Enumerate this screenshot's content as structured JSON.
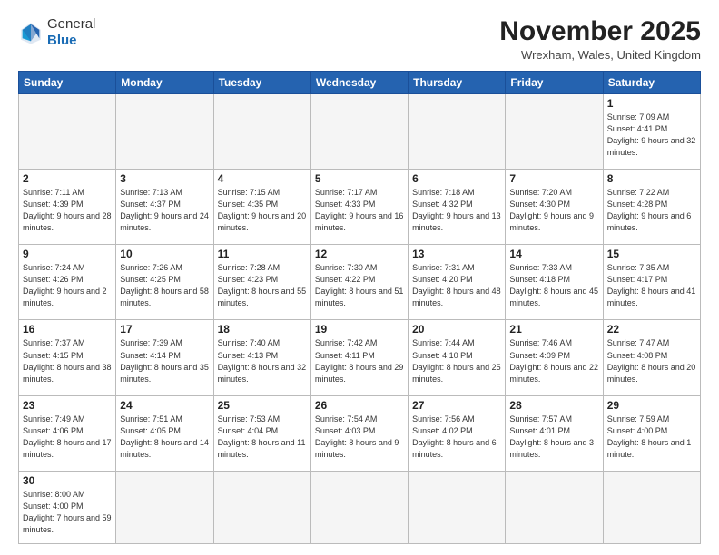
{
  "header": {
    "logo_general": "General",
    "logo_blue": "Blue",
    "title": "November 2025",
    "location": "Wrexham, Wales, United Kingdom"
  },
  "days_of_week": [
    "Sunday",
    "Monday",
    "Tuesday",
    "Wednesday",
    "Thursday",
    "Friday",
    "Saturday"
  ],
  "weeks": [
    [
      {
        "day": "",
        "info": ""
      },
      {
        "day": "",
        "info": ""
      },
      {
        "day": "",
        "info": ""
      },
      {
        "day": "",
        "info": ""
      },
      {
        "day": "",
        "info": ""
      },
      {
        "day": "",
        "info": ""
      },
      {
        "day": "1",
        "info": "Sunrise: 7:09 AM\nSunset: 4:41 PM\nDaylight: 9 hours and 32 minutes."
      }
    ],
    [
      {
        "day": "2",
        "info": "Sunrise: 7:11 AM\nSunset: 4:39 PM\nDaylight: 9 hours and 28 minutes."
      },
      {
        "day": "3",
        "info": "Sunrise: 7:13 AM\nSunset: 4:37 PM\nDaylight: 9 hours and 24 minutes."
      },
      {
        "day": "4",
        "info": "Sunrise: 7:15 AM\nSunset: 4:35 PM\nDaylight: 9 hours and 20 minutes."
      },
      {
        "day": "5",
        "info": "Sunrise: 7:17 AM\nSunset: 4:33 PM\nDaylight: 9 hours and 16 minutes."
      },
      {
        "day": "6",
        "info": "Sunrise: 7:18 AM\nSunset: 4:32 PM\nDaylight: 9 hours and 13 minutes."
      },
      {
        "day": "7",
        "info": "Sunrise: 7:20 AM\nSunset: 4:30 PM\nDaylight: 9 hours and 9 minutes."
      },
      {
        "day": "8",
        "info": "Sunrise: 7:22 AM\nSunset: 4:28 PM\nDaylight: 9 hours and 6 minutes."
      }
    ],
    [
      {
        "day": "9",
        "info": "Sunrise: 7:24 AM\nSunset: 4:26 PM\nDaylight: 9 hours and 2 minutes."
      },
      {
        "day": "10",
        "info": "Sunrise: 7:26 AM\nSunset: 4:25 PM\nDaylight: 8 hours and 58 minutes."
      },
      {
        "day": "11",
        "info": "Sunrise: 7:28 AM\nSunset: 4:23 PM\nDaylight: 8 hours and 55 minutes."
      },
      {
        "day": "12",
        "info": "Sunrise: 7:30 AM\nSunset: 4:22 PM\nDaylight: 8 hours and 51 minutes."
      },
      {
        "day": "13",
        "info": "Sunrise: 7:31 AM\nSunset: 4:20 PM\nDaylight: 8 hours and 48 minutes."
      },
      {
        "day": "14",
        "info": "Sunrise: 7:33 AM\nSunset: 4:18 PM\nDaylight: 8 hours and 45 minutes."
      },
      {
        "day": "15",
        "info": "Sunrise: 7:35 AM\nSunset: 4:17 PM\nDaylight: 8 hours and 41 minutes."
      }
    ],
    [
      {
        "day": "16",
        "info": "Sunrise: 7:37 AM\nSunset: 4:15 PM\nDaylight: 8 hours and 38 minutes."
      },
      {
        "day": "17",
        "info": "Sunrise: 7:39 AM\nSunset: 4:14 PM\nDaylight: 8 hours and 35 minutes."
      },
      {
        "day": "18",
        "info": "Sunrise: 7:40 AM\nSunset: 4:13 PM\nDaylight: 8 hours and 32 minutes."
      },
      {
        "day": "19",
        "info": "Sunrise: 7:42 AM\nSunset: 4:11 PM\nDaylight: 8 hours and 29 minutes."
      },
      {
        "day": "20",
        "info": "Sunrise: 7:44 AM\nSunset: 4:10 PM\nDaylight: 8 hours and 25 minutes."
      },
      {
        "day": "21",
        "info": "Sunrise: 7:46 AM\nSunset: 4:09 PM\nDaylight: 8 hours and 22 minutes."
      },
      {
        "day": "22",
        "info": "Sunrise: 7:47 AM\nSunset: 4:08 PM\nDaylight: 8 hours and 20 minutes."
      }
    ],
    [
      {
        "day": "23",
        "info": "Sunrise: 7:49 AM\nSunset: 4:06 PM\nDaylight: 8 hours and 17 minutes."
      },
      {
        "day": "24",
        "info": "Sunrise: 7:51 AM\nSunset: 4:05 PM\nDaylight: 8 hours and 14 minutes."
      },
      {
        "day": "25",
        "info": "Sunrise: 7:53 AM\nSunset: 4:04 PM\nDaylight: 8 hours and 11 minutes."
      },
      {
        "day": "26",
        "info": "Sunrise: 7:54 AM\nSunset: 4:03 PM\nDaylight: 8 hours and 9 minutes."
      },
      {
        "day": "27",
        "info": "Sunrise: 7:56 AM\nSunset: 4:02 PM\nDaylight: 8 hours and 6 minutes."
      },
      {
        "day": "28",
        "info": "Sunrise: 7:57 AM\nSunset: 4:01 PM\nDaylight: 8 hours and 3 minutes."
      },
      {
        "day": "29",
        "info": "Sunrise: 7:59 AM\nSunset: 4:00 PM\nDaylight: 8 hours and 1 minute."
      }
    ],
    [
      {
        "day": "30",
        "info": "Sunrise: 8:00 AM\nSunset: 4:00 PM\nDaylight: 7 hours and 59 minutes."
      },
      {
        "day": "",
        "info": ""
      },
      {
        "day": "",
        "info": ""
      },
      {
        "day": "",
        "info": ""
      },
      {
        "day": "",
        "info": ""
      },
      {
        "day": "",
        "info": ""
      },
      {
        "day": "",
        "info": ""
      }
    ]
  ]
}
